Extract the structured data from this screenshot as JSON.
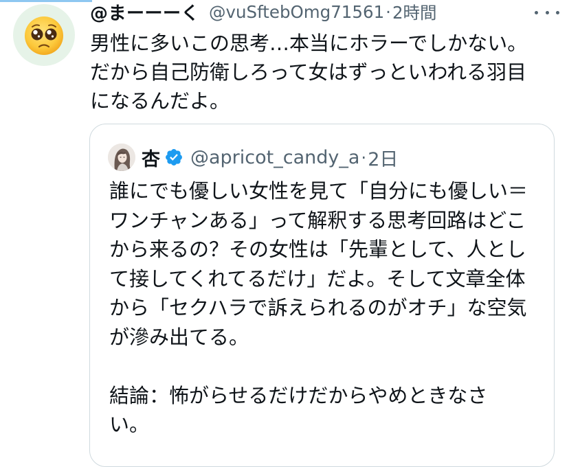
{
  "tweet": {
    "display_name": "@まーーーく",
    "handle": "@vuSftebOmg71561",
    "separator": "·",
    "time": "2時間",
    "avatar_icon": "pleading-face-emoji",
    "more_icon": "more-horizontal-icon",
    "text_lines": [
      "男性に多いこの思考…本当にホラーでしかない。",
      "だから自己防衛しろって女はずっといわれる羽目",
      "になるんだよ。"
    ]
  },
  "quote": {
    "display_name": "杏",
    "handle": "@apricot_candy_a",
    "separator": "·",
    "time": "2日",
    "verified_icon": "verified-badge-icon",
    "text_lines": [
      "誰にでも優しい女性を見て「自分にも優しい＝",
      "ワンチャンある」って解釈する思考回路はどこ",
      "から来るの？その女性は「先輩として、人とし",
      "て接してくれてるだけ」だよ。そして文章全体",
      "から「セクハラで訴えられるのがオチ」な空気",
      "が滲み出てる。",
      "",
      "結論：怖がらせるだけだからやめときなさ",
      "い。"
    ]
  },
  "colors": {
    "text_primary": "#0f1419",
    "text_secondary": "#536471",
    "border": "#cfd9de",
    "verified_blue": "#1d9bf0",
    "accent_bar": "#8ec7f1"
  }
}
